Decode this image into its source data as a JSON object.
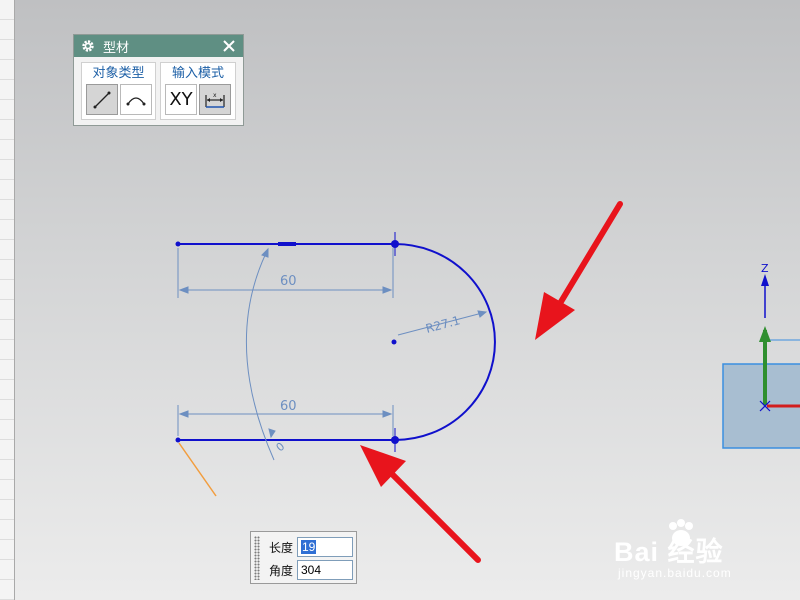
{
  "dialog": {
    "title": "型材",
    "object_type_label": "对象类型",
    "input_mode_label": "输入模式",
    "buttons": {
      "line": "line-icon",
      "arc": "arc-icon",
      "xy": "XY",
      "param": "parameter-mode-icon"
    }
  },
  "sketch": {
    "dim_top": "60",
    "dim_bottom": "60",
    "radius": "R27.1",
    "angle": "0"
  },
  "input_box": {
    "length_label": "长度",
    "length_value": "19",
    "angle_label": "角度",
    "angle_value": "304"
  },
  "triad": {
    "z_label": "Z"
  },
  "watermark": {
    "main": "Bai 经验",
    "sub": "jingyan.baidu.com"
  },
  "colors": {
    "geometry": "#1010cc",
    "dimension": "#6d8fc1",
    "arrow": "#e8141c",
    "preview_line": "#f29d3e",
    "dialog_title": "#5f8f83"
  }
}
